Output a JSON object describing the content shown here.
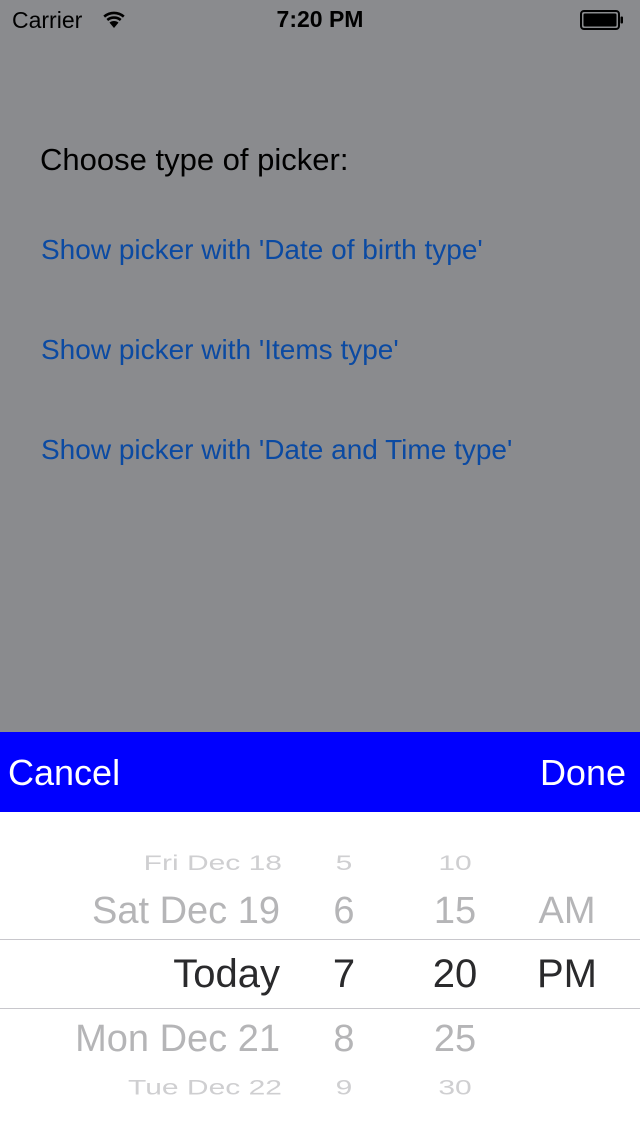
{
  "status_bar": {
    "carrier": "Carrier",
    "time": "7:20 PM",
    "wifi_icon": "wifi-icon",
    "battery_icon": "battery-icon"
  },
  "main": {
    "heading": "Choose type of picker:",
    "links": [
      "Show picker with 'Date of birth type'",
      "Show picker with 'Items type'",
      "Show picker with 'Date and Time type'"
    ]
  },
  "toolbar": {
    "cancel_label": "Cancel",
    "done_label": "Done",
    "background_color": "#0000ff"
  },
  "picker": {
    "dates": [
      "Fri Dec 18",
      "Sat Dec 19",
      "Today",
      "Mon Dec 21",
      "Tue Dec 22"
    ],
    "hours": [
      "5",
      "6",
      "7",
      "8",
      "9"
    ],
    "minutes": [
      "10",
      "15",
      "20",
      "25",
      "30"
    ],
    "ampm": [
      "AM",
      "PM"
    ],
    "selected": {
      "date": "Today",
      "hour": "7",
      "minute": "20",
      "ampm": "PM"
    }
  },
  "colors": {
    "dim_background": "#8a8b8e",
    "link": "#0b4aa2"
  }
}
